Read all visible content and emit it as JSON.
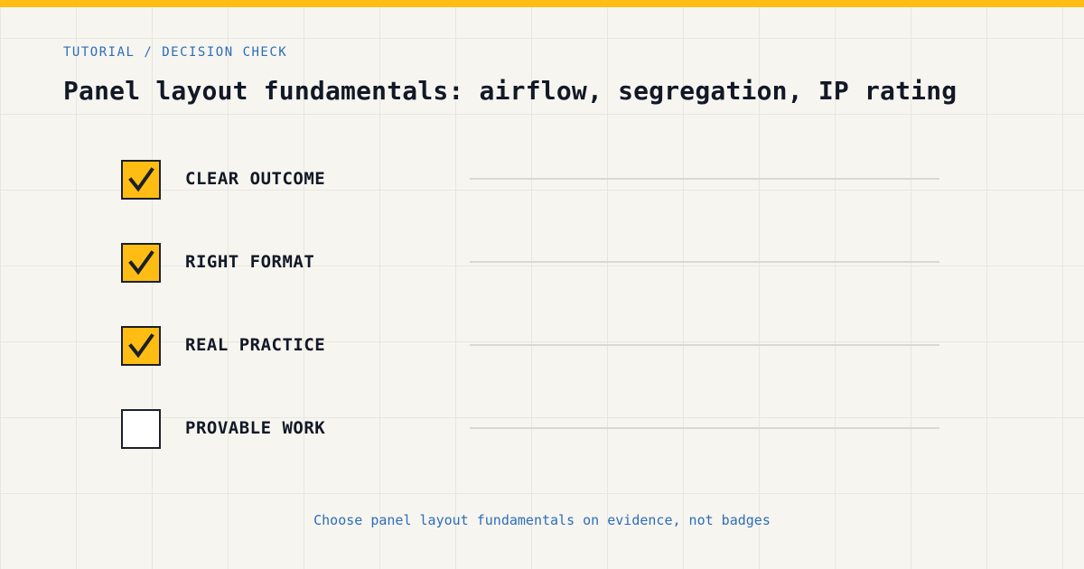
{
  "breadcrumb": "TUTORIAL / DECISION CHECK",
  "title": "Panel layout fundamentals: airflow, segregation, IP rating",
  "checklist": [
    {
      "label": "CLEAR OUTCOME",
      "checked": true
    },
    {
      "label": "RIGHT FORMAT",
      "checked": true
    },
    {
      "label": "REAL PRACTICE",
      "checked": true
    },
    {
      "label": "PROVABLE WORK",
      "checked": false
    }
  ],
  "footer": "Choose panel layout fundamentals on evidence, not badges",
  "colors": {
    "accent": "#ffbd14",
    "link_blue": "#2d6db8",
    "text_dark": "#121826",
    "background": "#f6f5f0"
  },
  "icons": {
    "checked": "checkmark-icon"
  }
}
